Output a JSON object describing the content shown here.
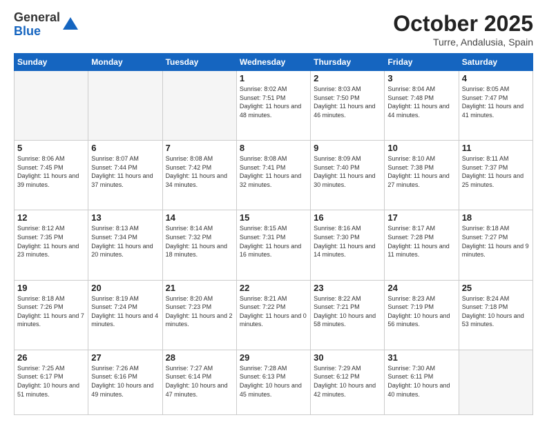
{
  "header": {
    "logo_line1": "General",
    "logo_line2": "Blue",
    "month": "October 2025",
    "location": "Turre, Andalusia, Spain"
  },
  "days_of_week": [
    "Sunday",
    "Monday",
    "Tuesday",
    "Wednesday",
    "Thursday",
    "Friday",
    "Saturday"
  ],
  "weeks": [
    [
      {
        "day": "",
        "info": ""
      },
      {
        "day": "",
        "info": ""
      },
      {
        "day": "",
        "info": ""
      },
      {
        "day": "1",
        "info": "Sunrise: 8:02 AM\nSunset: 7:51 PM\nDaylight: 11 hours\nand 48 minutes."
      },
      {
        "day": "2",
        "info": "Sunrise: 8:03 AM\nSunset: 7:50 PM\nDaylight: 11 hours\nand 46 minutes."
      },
      {
        "day": "3",
        "info": "Sunrise: 8:04 AM\nSunset: 7:48 PM\nDaylight: 11 hours\nand 44 minutes."
      },
      {
        "day": "4",
        "info": "Sunrise: 8:05 AM\nSunset: 7:47 PM\nDaylight: 11 hours\nand 41 minutes."
      }
    ],
    [
      {
        "day": "5",
        "info": "Sunrise: 8:06 AM\nSunset: 7:45 PM\nDaylight: 11 hours\nand 39 minutes."
      },
      {
        "day": "6",
        "info": "Sunrise: 8:07 AM\nSunset: 7:44 PM\nDaylight: 11 hours\nand 37 minutes."
      },
      {
        "day": "7",
        "info": "Sunrise: 8:08 AM\nSunset: 7:42 PM\nDaylight: 11 hours\nand 34 minutes."
      },
      {
        "day": "8",
        "info": "Sunrise: 8:08 AM\nSunset: 7:41 PM\nDaylight: 11 hours\nand 32 minutes."
      },
      {
        "day": "9",
        "info": "Sunrise: 8:09 AM\nSunset: 7:40 PM\nDaylight: 11 hours\nand 30 minutes."
      },
      {
        "day": "10",
        "info": "Sunrise: 8:10 AM\nSunset: 7:38 PM\nDaylight: 11 hours\nand 27 minutes."
      },
      {
        "day": "11",
        "info": "Sunrise: 8:11 AM\nSunset: 7:37 PM\nDaylight: 11 hours\nand 25 minutes."
      }
    ],
    [
      {
        "day": "12",
        "info": "Sunrise: 8:12 AM\nSunset: 7:35 PM\nDaylight: 11 hours\nand 23 minutes."
      },
      {
        "day": "13",
        "info": "Sunrise: 8:13 AM\nSunset: 7:34 PM\nDaylight: 11 hours\nand 20 minutes."
      },
      {
        "day": "14",
        "info": "Sunrise: 8:14 AM\nSunset: 7:32 PM\nDaylight: 11 hours\nand 18 minutes."
      },
      {
        "day": "15",
        "info": "Sunrise: 8:15 AM\nSunset: 7:31 PM\nDaylight: 11 hours\nand 16 minutes."
      },
      {
        "day": "16",
        "info": "Sunrise: 8:16 AM\nSunset: 7:30 PM\nDaylight: 11 hours\nand 14 minutes."
      },
      {
        "day": "17",
        "info": "Sunrise: 8:17 AM\nSunset: 7:28 PM\nDaylight: 11 hours\nand 11 minutes."
      },
      {
        "day": "18",
        "info": "Sunrise: 8:18 AM\nSunset: 7:27 PM\nDaylight: 11 hours\nand 9 minutes."
      }
    ],
    [
      {
        "day": "19",
        "info": "Sunrise: 8:18 AM\nSunset: 7:26 PM\nDaylight: 11 hours\nand 7 minutes."
      },
      {
        "day": "20",
        "info": "Sunrise: 8:19 AM\nSunset: 7:24 PM\nDaylight: 11 hours\nand 4 minutes."
      },
      {
        "day": "21",
        "info": "Sunrise: 8:20 AM\nSunset: 7:23 PM\nDaylight: 11 hours\nand 2 minutes."
      },
      {
        "day": "22",
        "info": "Sunrise: 8:21 AM\nSunset: 7:22 PM\nDaylight: 11 hours\nand 0 minutes."
      },
      {
        "day": "23",
        "info": "Sunrise: 8:22 AM\nSunset: 7:21 PM\nDaylight: 10 hours\nand 58 minutes."
      },
      {
        "day": "24",
        "info": "Sunrise: 8:23 AM\nSunset: 7:19 PM\nDaylight: 10 hours\nand 56 minutes."
      },
      {
        "day": "25",
        "info": "Sunrise: 8:24 AM\nSunset: 7:18 PM\nDaylight: 10 hours\nand 53 minutes."
      }
    ],
    [
      {
        "day": "26",
        "info": "Sunrise: 7:25 AM\nSunset: 6:17 PM\nDaylight: 10 hours\nand 51 minutes."
      },
      {
        "day": "27",
        "info": "Sunrise: 7:26 AM\nSunset: 6:16 PM\nDaylight: 10 hours\nand 49 minutes."
      },
      {
        "day": "28",
        "info": "Sunrise: 7:27 AM\nSunset: 6:14 PM\nDaylight: 10 hours\nand 47 minutes."
      },
      {
        "day": "29",
        "info": "Sunrise: 7:28 AM\nSunset: 6:13 PM\nDaylight: 10 hours\nand 45 minutes."
      },
      {
        "day": "30",
        "info": "Sunrise: 7:29 AM\nSunset: 6:12 PM\nDaylight: 10 hours\nand 42 minutes."
      },
      {
        "day": "31",
        "info": "Sunrise: 7:30 AM\nSunset: 6:11 PM\nDaylight: 10 hours\nand 40 minutes."
      },
      {
        "day": "",
        "info": ""
      }
    ]
  ]
}
